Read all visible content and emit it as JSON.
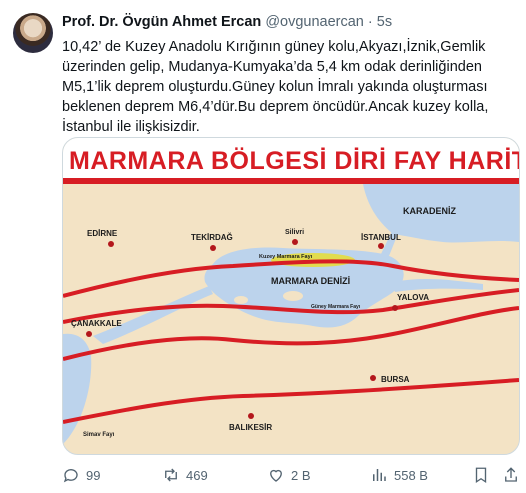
{
  "author": {
    "name": "Prof. Dr. Övgün Ahmet Ercan",
    "handle": "@ovgunaercan",
    "separator": "·",
    "time": "5s"
  },
  "tweet_text": "10,42’ de Kuzey Anadolu Kırığının güney kolu,Akyazı,İznik,Gemlik üzerinden gelip, Mudanya-Kumyaka’da 5,4 km odak derinliğinden M5,1’lik deprem oluşturdu.Güney kolun İmralı yakında oluşturması beklenen deprem M6,4’dür.Bu deprem öncüdür.Ancak kuzey kolla, İstanbul ile ilişkisizdir.",
  "map": {
    "title": "MARMARA BÖLGESİ DİRİ FAY HARİTASI",
    "labels": {
      "karadeniz": "KARADENİZ",
      "edirne": "EDİRNE",
      "tekirdag": "TEKİRDAĞ",
      "silivri": "Silivri",
      "istanbul": "İSTANBUL",
      "kuzey_marmara": "Kuzey Marmara Fayı",
      "marmara_denizi": "MARMARA DENİZİ",
      "guney_marmara": "Güney Marmara Fayı",
      "yalova": "YALOVA",
      "canakkale": "ÇANAKKALE",
      "bursa": "BURSA",
      "balikesir": "BALIKESİR",
      "simav": "Simav Fayı"
    },
    "colors": {
      "land": "#f3e3c5",
      "sea": "#bcd3ec",
      "fault": "#d71d24",
      "highlight": "#e4dd3e"
    }
  },
  "actions": {
    "replies": "99",
    "reposts": "469",
    "likes": "2 B",
    "views": "558 B"
  }
}
